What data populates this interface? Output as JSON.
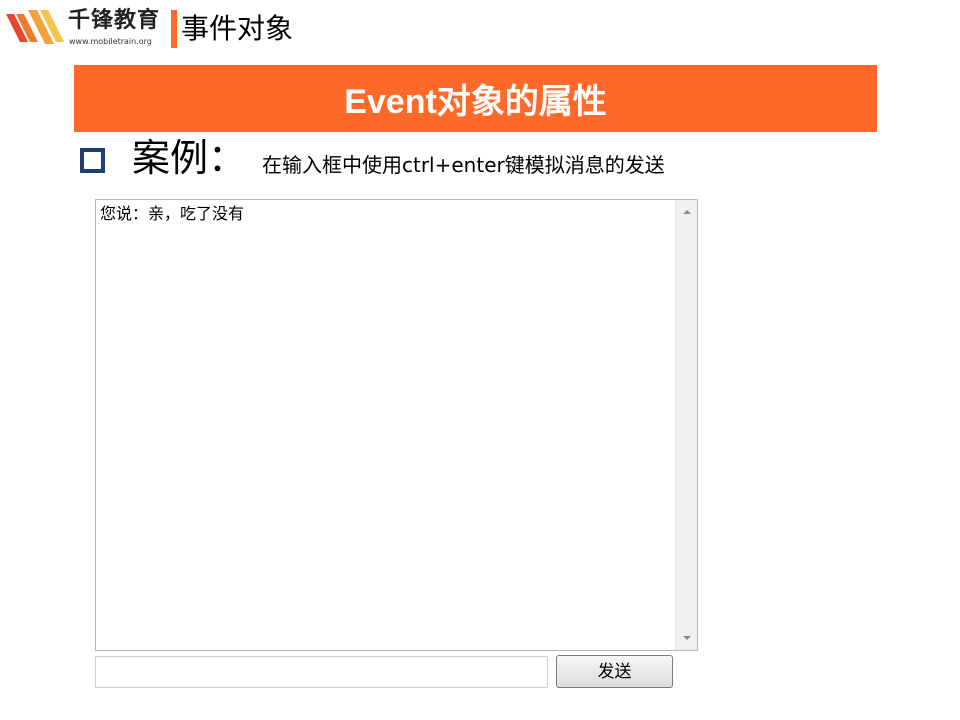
{
  "header": {
    "brand_name": "千锋教育",
    "brand_url": "www.mobiletrain.org",
    "section_title": "事件对象"
  },
  "banner": {
    "title": "Event对象的属性"
  },
  "case": {
    "label": "案例：",
    "description": "在输入框中使用ctrl+enter键模拟消息的发送"
  },
  "chat": {
    "message": "您说：亲，吃了没有"
  },
  "input": {
    "value": ""
  },
  "send_button": {
    "label": "发送"
  },
  "colors": {
    "accent": "#ff6a2b",
    "bullet_border": "#1f3f73"
  }
}
